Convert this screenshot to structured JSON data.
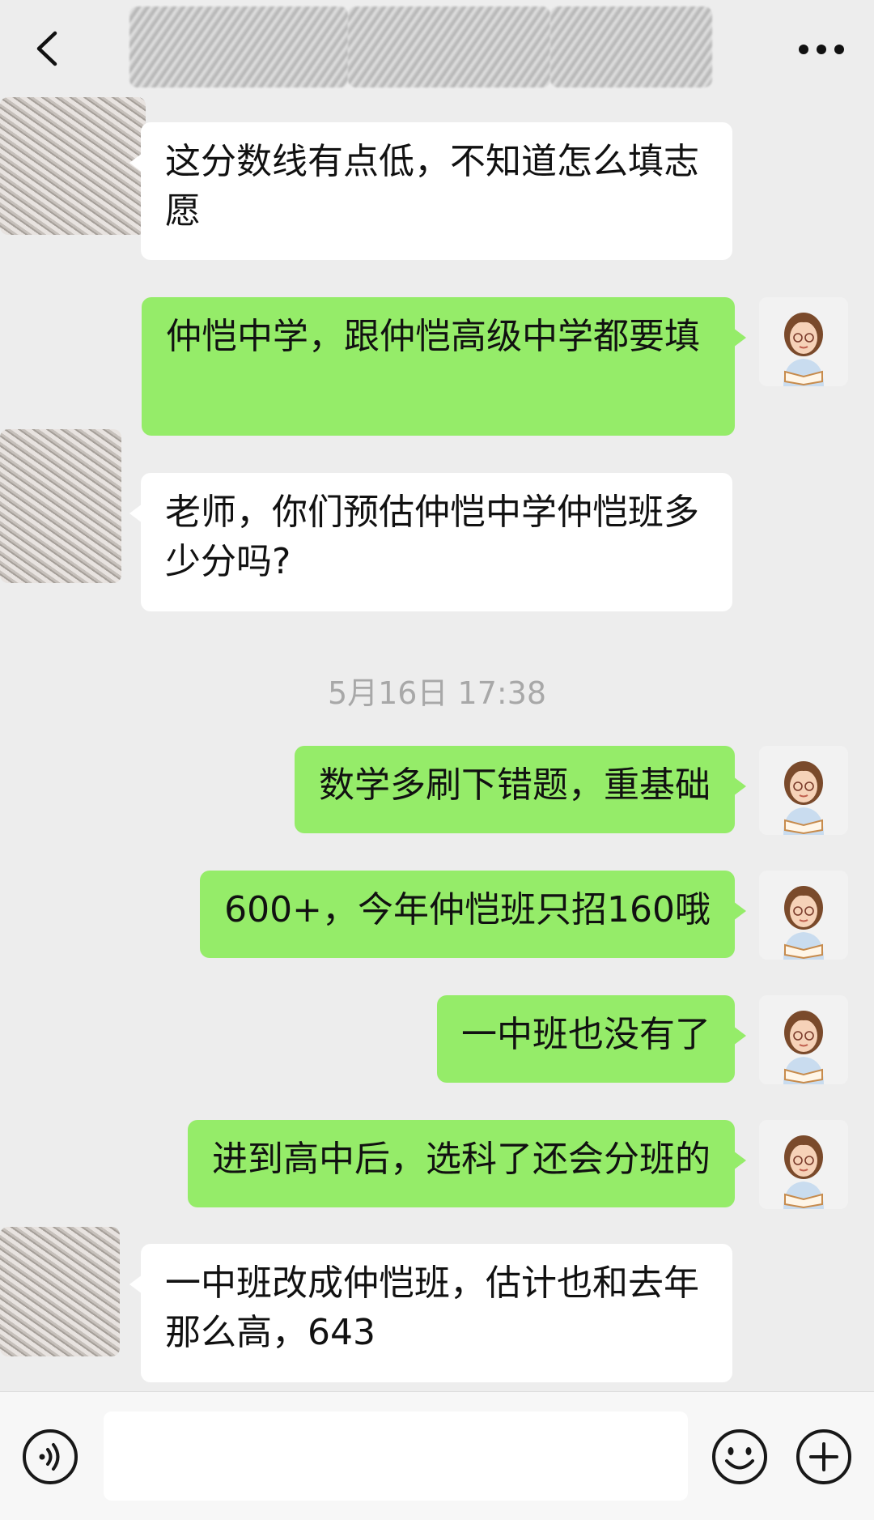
{
  "header": {
    "back_icon": "chevron-left-icon",
    "more_icon": "more-dots-icon"
  },
  "messages": [
    {
      "direction": "in",
      "text": "这分数线有点低，不知道怎么填志愿"
    },
    {
      "direction": "out",
      "text": "仲恺中学，跟仲恺高级中学都要填"
    },
    {
      "direction": "in",
      "text": "老师，你们预估仲恺中学仲恺班多少分吗?"
    },
    {
      "direction": "out",
      "text": "数学多刷下错题，重基础"
    },
    {
      "direction": "out",
      "text": "600+，今年仲恺班只招160哦"
    },
    {
      "direction": "out",
      "text": "一中班也没有了"
    },
    {
      "direction": "out",
      "text": "进到高中后，选科了还会分班的"
    },
    {
      "direction": "in",
      "text": "一中班改成仲恺班，估计也和去年那么高，643"
    }
  ],
  "timestamp": "5月16日 17:38",
  "input_bar": {
    "placeholder": "",
    "voice_icon": "voice-icon",
    "emoji_icon": "emoji-icon",
    "plus_icon": "plus-icon"
  },
  "colors": {
    "background": "#ededed",
    "bubble_out": "#95ec69",
    "bubble_in": "#ffffff"
  }
}
